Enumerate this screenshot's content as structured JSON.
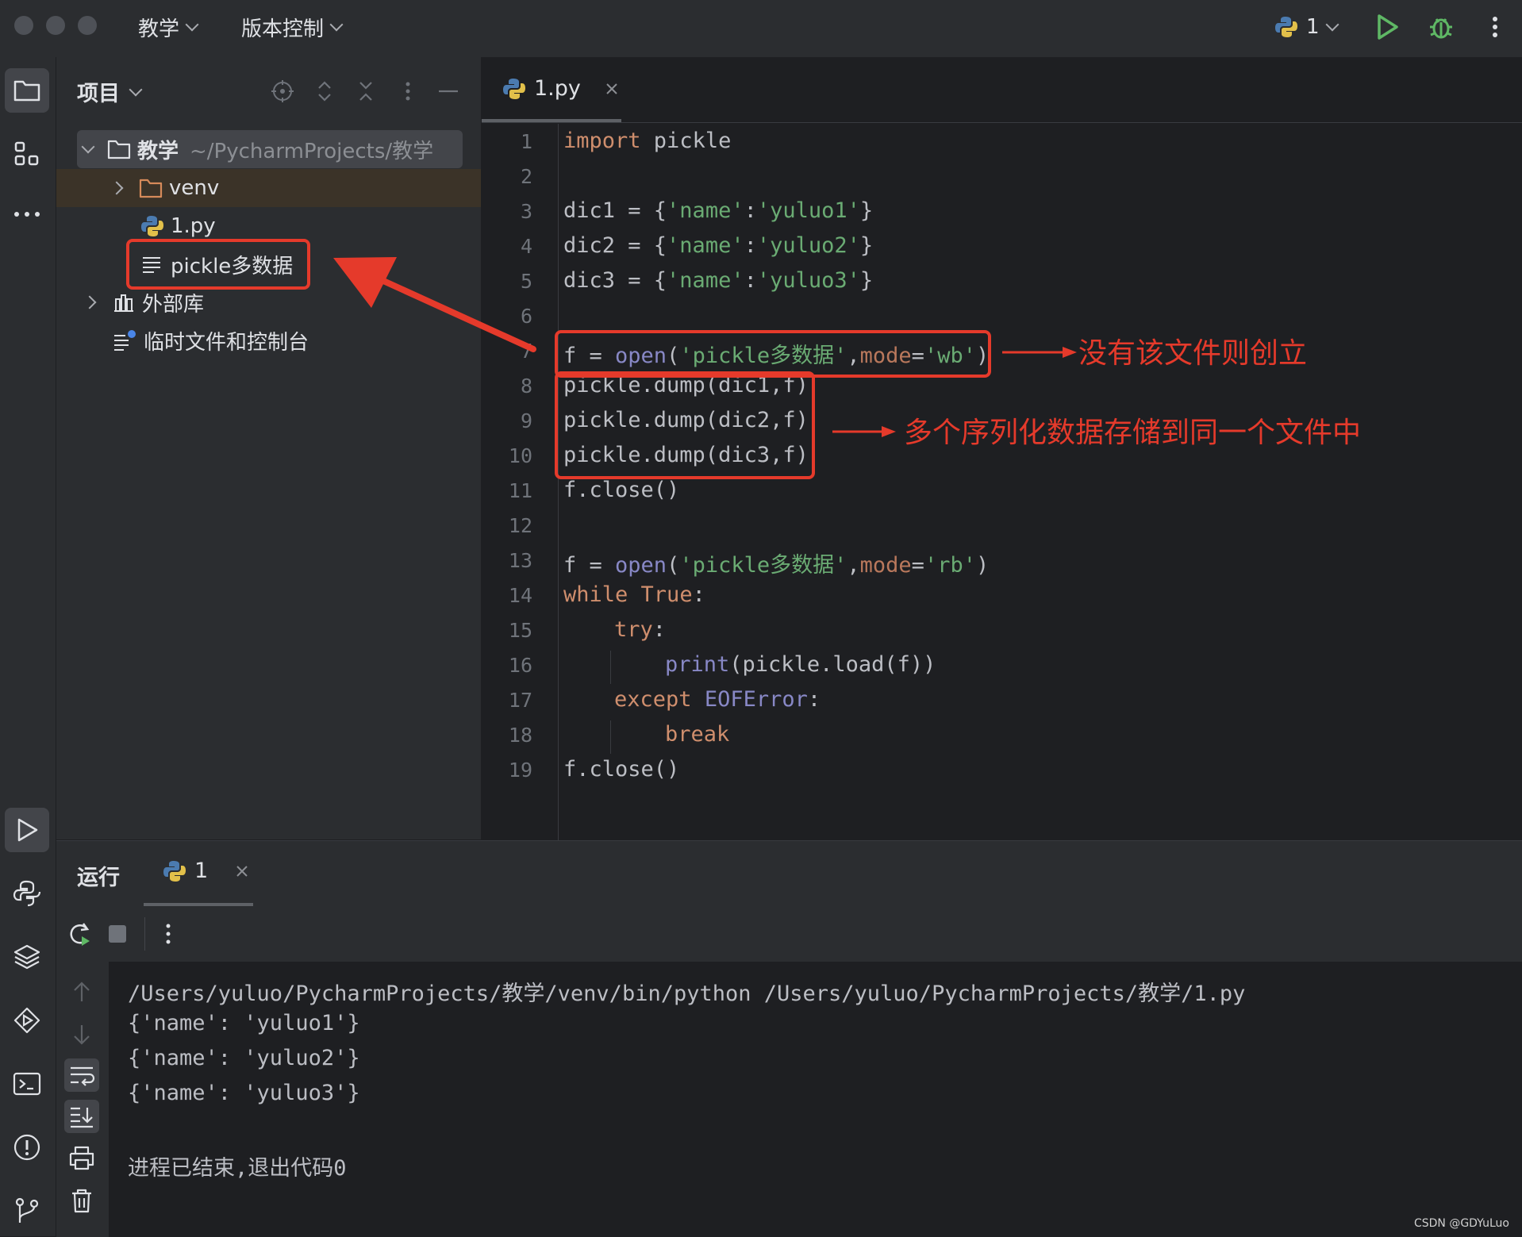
{
  "titlebar": {
    "project_menu": "教学",
    "vcs_menu": "版本控制",
    "run_config": "1"
  },
  "project_panel": {
    "title": "项目",
    "tree": [
      {
        "label": "教学",
        "path": "~/PycharmProjects/教学"
      },
      {
        "label": "venv"
      },
      {
        "label": "1.py"
      },
      {
        "label": "pickle多数据"
      },
      {
        "label": "外部库"
      },
      {
        "label": "临时文件和控制台"
      }
    ]
  },
  "editor": {
    "tab": "1.py",
    "line_numbers": [
      "1",
      "2",
      "3",
      "4",
      "5",
      "6",
      "7",
      "8",
      "9",
      "10",
      "11",
      "12",
      "13",
      "14",
      "15",
      "16",
      "17",
      "18",
      "19"
    ],
    "code": {
      "l1_kw": "import",
      "l1_rest": " pickle",
      "l3_a": "dic1 = {",
      "l3_s1": "'name'",
      "l3_c": ":",
      "l3_s2": "'yuluo1'",
      "l3_e": "}",
      "l4_a": "dic2 = {",
      "l4_s1": "'name'",
      "l4_c": ":",
      "l4_s2": "'yuluo2'",
      "l4_e": "}",
      "l5_a": "dic3 = {",
      "l5_s1": "'name'",
      "l5_c": ":",
      "l5_s2": "'yuluo3'",
      "l5_e": "}",
      "l7_a": "f = ",
      "l7_fn": "open",
      "l7_p": "(",
      "l7_s1": "'pickle多数据'",
      "l7_comma": ",",
      "l7_param": "mode",
      "l7_eq": "=",
      "l7_s2": "'wb'",
      "l7_e": ")",
      "l8": "pickle.dump(dic1,f)",
      "l9": "pickle.dump(dic2,f)",
      "l10": "pickle.dump(dic3,f)",
      "l11": "f.close()",
      "l13_a": "f = ",
      "l13_fn": "open",
      "l13_p": "(",
      "l13_s1": "'pickle多数据'",
      "l13_comma": ",",
      "l13_param": "mode",
      "l13_eq": "=",
      "l13_s2": "'rb'",
      "l13_e": ")",
      "l14_kw": "while",
      "l14_sp": " ",
      "l14_kw2": "True",
      "l14_e": ":",
      "l15_kw": "try",
      "l15_e": ":",
      "l16_fn": "print",
      "l16_rest": "(pickle.load(f))",
      "l17_kw": "except",
      "l17_sp": " ",
      "l17_cls": "EOFError",
      "l17_e": ":",
      "l18_kw": "break",
      "l19": "f.close()"
    },
    "annotations": {
      "create_note": "没有该文件则创立",
      "multi_note": "多个序列化数据存储到同一个文件中"
    }
  },
  "run_panel": {
    "title": "运行",
    "tab": "1",
    "output": [
      "/Users/yuluo/PycharmProjects/教学/venv/bin/python /Users/yuluo/PycharmProjects/教学/1.py",
      "{'name': 'yuluo1'}",
      "{'name': 'yuluo2'}",
      "{'name': 'yuluo3'}",
      "",
      "进程已结束,退出代码0"
    ]
  },
  "watermark": "CSDN @GDYuLuo",
  "colors": {
    "annotation_red": "#e53a2b",
    "keyword": "#cf8e6d",
    "string": "#6aab73",
    "function": "#a993d6",
    "run_green": "#5fb865"
  }
}
